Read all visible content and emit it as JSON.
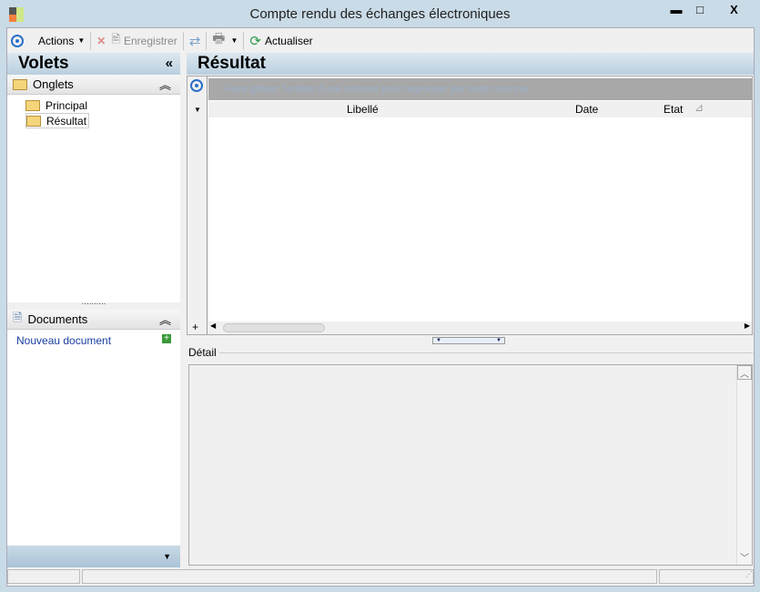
{
  "window": {
    "title": "Compte rendu des échanges électroniques",
    "minimize": "▬",
    "maximize": "□",
    "close": "X"
  },
  "toolbar": {
    "actions": "Actions",
    "save": "Enregistrer",
    "refresh": "Actualiser"
  },
  "left": {
    "title": "Volets",
    "collapse": "«",
    "tabs_section": "Onglets",
    "tabs": [
      "Principal",
      "Résultat"
    ],
    "documents_section": "Documents",
    "new_document": "Nouveau document"
  },
  "main": {
    "title": "Résultat",
    "group_hint": "Faire glisser l'entête d'une colonne pour regrouper par cette colonne.",
    "columns": [
      "Libellé",
      "Date",
      "Etat"
    ],
    "detail_label": "Détail"
  }
}
